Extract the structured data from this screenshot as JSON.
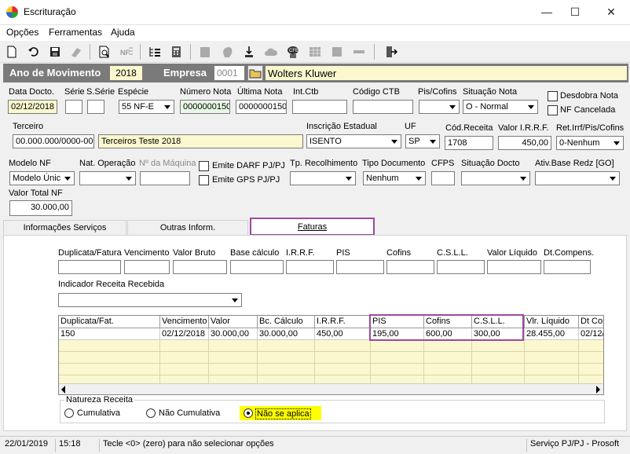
{
  "window": {
    "title": "Escrituração",
    "minimize": "—",
    "maximize": "☐",
    "close": "✕"
  },
  "menu": [
    {
      "label": "Opções",
      "hotkey": "O"
    },
    {
      "label": "Ferramentas",
      "hotkey": "F"
    },
    {
      "label": "Ajuda",
      "hotkey": "A"
    }
  ],
  "header": {
    "ano_label": "Ano de Movimento",
    "ano_value": "2018",
    "empresa_label": "Empresa",
    "empresa_code": "0001",
    "empresa_name": "Wolters Kluwer"
  },
  "row1": {
    "data_docto": {
      "label": "Data Docto.",
      "value": "02/12/2018"
    },
    "serie": {
      "label": "Série",
      "value": ""
    },
    "sserie": {
      "label": "S.Série",
      "value": ""
    },
    "especie": {
      "label": "Espécie",
      "value": "55 NF-E"
    },
    "numero_nota": {
      "label": "Número Nota",
      "value": "0000000150"
    },
    "ultima_nota": {
      "label": "Última Nota",
      "value": "0000000150"
    },
    "int_ctb": {
      "label": "Int.Ctb",
      "value": ""
    },
    "codigo_ctb": {
      "label": "Código CTB",
      "value": ""
    },
    "pis_cofins": {
      "label": "Pis/Cofins",
      "value": ""
    },
    "situacao_nota": {
      "label": "Situação Nota",
      "value": "O - Normal"
    },
    "desdobra_nota": "Desdobra Nota",
    "nf_cancelada": "NF Cancelada"
  },
  "row2": {
    "terceiro": {
      "label": "Terceiro",
      "cnpj": "00.000.000/0000-00",
      "name": "Terceiros Teste 2018"
    },
    "inscricao_estadual": {
      "label": "Inscrição Estadual",
      "value": "ISENTO"
    },
    "uf": {
      "label": "UF",
      "value": "SP"
    },
    "cod_receita": {
      "label": "Cód.Receita",
      "value": "1708"
    },
    "valor_irrf": {
      "label": "Valor I.R.R.F.",
      "value": "450,00"
    },
    "ret_irrf": {
      "label": "Ret.Irrf/Pis/Cofins",
      "value": "0-Nenhum"
    }
  },
  "row3": {
    "modelo_nf": {
      "label": "Modelo NF",
      "value": "Modelo Únic"
    },
    "nat_operacao": {
      "label": "Nat. Operação",
      "value": ""
    },
    "n_maquina": {
      "label": "Nº da Máquina",
      "value": ""
    },
    "emite_darf": "Emite DARF PJ/PJ",
    "emite_gps": "Emite GPS PJ/PJ",
    "tp_recolhimento": {
      "label": "Tp. Recolhimento",
      "value": ""
    },
    "tipo_documento": {
      "label": "Tipo Documento",
      "value": "Nenhum"
    },
    "cfps": {
      "label": "CFPS",
      "value": ""
    },
    "situacao_docto": {
      "label": "Situação Docto",
      "value": ""
    },
    "ativ_base": {
      "label": "Ativ.Base Redz [GO]",
      "value": ""
    }
  },
  "valor_total": {
    "label": "Valor Total NF",
    "value": "30.000,00"
  },
  "tabs": [
    {
      "label": "Informações Serviços"
    },
    {
      "label": "Outras Inform."
    },
    {
      "label": "Faturas"
    }
  ],
  "faturas": {
    "fields": [
      "Duplicata/Fatura",
      "Vencimento",
      "Valor Bruto",
      "Base cálculo",
      "I.R.R.F.",
      "PIS",
      "Cofins",
      "C.S.L.L.",
      "Valor Líquido",
      "Dt.Compens."
    ],
    "indicador_label": "Indicador Receita Recebida",
    "indicador_value": "",
    "grid_headers": [
      "Duplicata/Fat.",
      "Vencimento",
      "Valor",
      "Bc. Cálculo",
      "I.R.R.F.",
      "PIS",
      "Cofins",
      "C.S.L.L.",
      "Vlr. Líquido",
      "Dt Com"
    ],
    "grid_row": [
      "150",
      "02/12/2018",
      "30.000,00",
      "30.000,00",
      "450,00",
      "195,00",
      "600,00",
      "300,00",
      "28.455,00",
      "02/12/"
    ],
    "natureza_label": "Natureza Receita",
    "natureza_options": [
      "Cumulativa",
      "Não Cumulativa",
      "Não se aplica"
    ],
    "natureza_selected": 2
  },
  "status": {
    "date": "22/01/2019",
    "time": "15:18",
    "message": "Tecle <0> (zero) para não selecionar opções",
    "service": "Serviço PJ/PJ - Prosoft"
  },
  "colors": {
    "header_band": "#7a7a7a",
    "yellow_field": "#fbf8cf",
    "highlight": "#9b4a9e"
  }
}
